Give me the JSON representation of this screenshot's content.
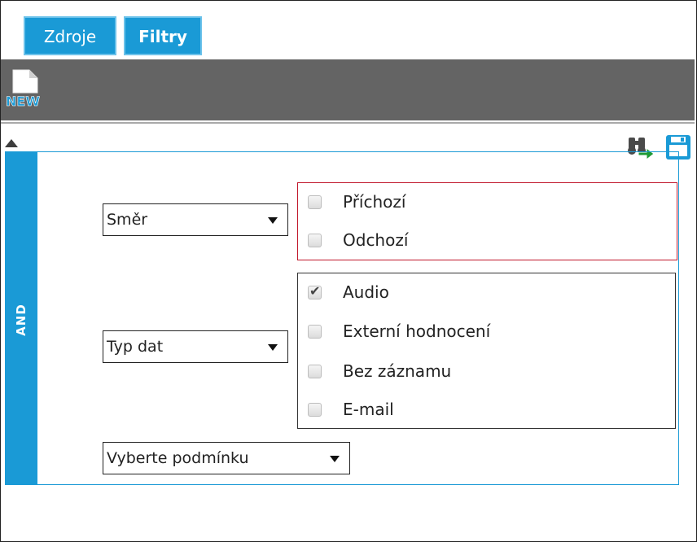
{
  "tabs": {
    "sources": "Zdroje",
    "filters": "Filtry"
  },
  "toolbar": {
    "new_icon_label": "NEW"
  },
  "filter_group": {
    "operator": "AND",
    "conditions": [
      {
        "field": "Směr",
        "options": [
          {
            "label": "Příchozí",
            "checked": false
          },
          {
            "label": "Odchozí",
            "checked": false
          }
        ]
      },
      {
        "field": "Typ dat",
        "options": [
          {
            "label": "Audio",
            "checked": true
          },
          {
            "label": "Externí hodnocení",
            "checked": false
          },
          {
            "label": "Bez záznamu",
            "checked": false
          },
          {
            "label": "E-mail",
            "checked": false
          }
        ]
      }
    ],
    "add_condition_placeholder": "Vyberte podmínku"
  },
  "colors": {
    "accent": "#1a9ad6",
    "toolbar": "#646464",
    "error_border": "#c0162a"
  }
}
